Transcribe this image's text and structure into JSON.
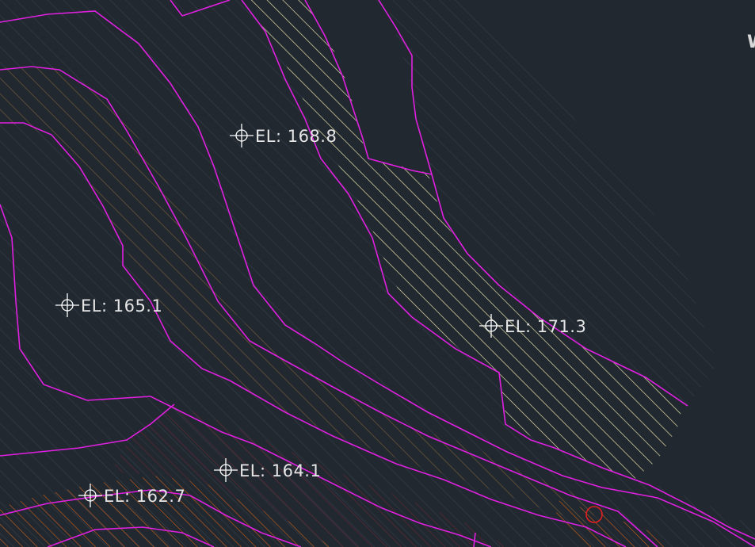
{
  "drawing": {
    "contour_color": "#e020e0",
    "marker_color": "#ffffff",
    "text_color": "#e6e6e6",
    "background": "#212830",
    "cursor_color": "#e02020",
    "hatch_colors": {
      "dark": "#323a44",
      "brown": "#5c4a2c",
      "orange": "#a0501e",
      "cream": "#e0dca8",
      "maroon": "#5a2630"
    }
  },
  "elevation_labels": [
    {
      "id": "el-168-8",
      "text": "EL: 168.8"
    },
    {
      "id": "el-165-1",
      "text": "EL: 165.1"
    },
    {
      "id": "el-171-3",
      "text": "EL: 171.3"
    },
    {
      "id": "el-164-1",
      "text": "EL: 164.1"
    },
    {
      "id": "el-162-7",
      "text": "EL: 162.7"
    }
  ],
  "cutoff_text": "W"
}
